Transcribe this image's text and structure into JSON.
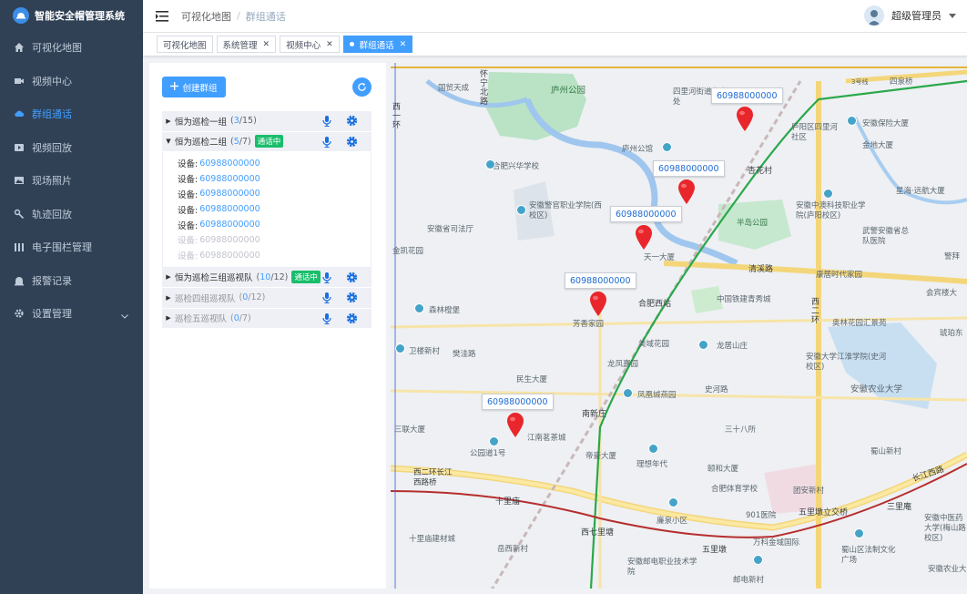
{
  "app": {
    "title": "智能安全帽管理系统"
  },
  "sidebar": {
    "items": [
      {
        "label": "可视化地图",
        "icon": "home-icon",
        "active": false
      },
      {
        "label": "视频中心",
        "icon": "video-camera-icon",
        "active": false
      },
      {
        "label": "群组通话",
        "icon": "cloud-icon",
        "active": true
      },
      {
        "label": "视频回放",
        "icon": "playback-icon",
        "active": false
      },
      {
        "label": "现场照片",
        "icon": "photo-icon",
        "active": false
      },
      {
        "label": "轨迹回放",
        "icon": "track-icon",
        "active": false
      },
      {
        "label": "电子围栏管理",
        "icon": "fence-icon",
        "active": false
      },
      {
        "label": "报警记录",
        "icon": "alarm-icon",
        "active": false
      },
      {
        "label": "设置管理",
        "icon": "settings-icon",
        "active": false
      }
    ]
  },
  "header": {
    "breadcrumb": [
      "可视化地图",
      "群组通话"
    ],
    "separator": "/",
    "user": "超级管理员"
  },
  "tags": [
    {
      "label": "可视化地图",
      "closable": false,
      "active": false
    },
    {
      "label": "系统管理",
      "closable": true,
      "active": false
    },
    {
      "label": "视频中心",
      "closable": true,
      "active": false
    },
    {
      "label": "群组通话",
      "closable": true,
      "active": true
    }
  ],
  "panel": {
    "create_label": "创建群组",
    "groups": [
      {
        "name": "恒为巡检一组",
        "online": "3",
        "total": "/15",
        "expanded": false,
        "live": "",
        "dim": false
      },
      {
        "name": "恒为巡检二组",
        "online": "5",
        "total": "/7",
        "expanded": true,
        "live": "通话中",
        "dim": false,
        "members": [
          {
            "label": "设备:",
            "id": "60988000000",
            "online": true
          },
          {
            "label": "设备:",
            "id": "60988000000",
            "online": true
          },
          {
            "label": "设备:",
            "id": "60988000000",
            "online": true
          },
          {
            "label": "设备:",
            "id": "60988000000",
            "online": true
          },
          {
            "label": "设备:",
            "id": "60988000000",
            "online": true
          },
          {
            "label": "设备:",
            "id": "60988000000",
            "online": false
          },
          {
            "label": "设备:",
            "id": "60988000000",
            "online": false
          }
        ]
      },
      {
        "name": "恒为巡检三组巡视队",
        "online": "10",
        "total": "/12",
        "expanded": false,
        "live": "通话中",
        "dim": false
      },
      {
        "name": "巡检四组巡视队",
        "online": "0",
        "total": "/12",
        "expanded": false,
        "live": "",
        "dim": true
      },
      {
        "name": "巡检五巡视队",
        "online": "0",
        "total": "/7",
        "expanded": false,
        "live": "",
        "dim": true
      }
    ]
  },
  "map": {
    "markers": [
      {
        "label": "60988000000"
      },
      {
        "label": "60988000000"
      },
      {
        "label": "60988000000"
      },
      {
        "label": "60988000000"
      },
      {
        "label": "60988000000"
      }
    ],
    "places": [
      {
        "text": "国贸天成"
      },
      {
        "text": "庐州公园"
      },
      {
        "text": "四里河街道办事处"
      },
      {
        "text": "四泉桥"
      },
      {
        "text": "庐阳区四里河社区"
      },
      {
        "text": "安徽保险大厦"
      },
      {
        "text": "金地大厦"
      },
      {
        "text": "杏花村"
      },
      {
        "text": "庐州公馆"
      },
      {
        "text": "合肥兴华学校"
      },
      {
        "text": "星海·远航大厦"
      },
      {
        "text": "安徽警官职业学院(西校区)"
      },
      {
        "text": "安徽中澳科技职业学院(庐阳校区)"
      },
      {
        "text": "安徽省司法厅"
      },
      {
        "text": "半岛公园"
      },
      {
        "text": "金凯花园"
      },
      {
        "text": "武警安徽省总队医院"
      },
      {
        "text": "天一大厦"
      },
      {
        "text": "清溪路"
      },
      {
        "text": "康居时代家园"
      },
      {
        "text": "森林橙堡"
      },
      {
        "text": "中国铁建青秀城"
      },
      {
        "text": "合肥西站"
      },
      {
        "text": "芳香家园"
      },
      {
        "text": "奥林花园汇景苑"
      },
      {
        "text": "卫楼新村"
      },
      {
        "text": "樊洼路"
      },
      {
        "text": "美域花园"
      },
      {
        "text": "龙居山庄"
      },
      {
        "text": "安徽大学江淮学院(史河校区)"
      },
      {
        "text": "龙凤嘉园"
      },
      {
        "text": "民生大厦"
      },
      {
        "text": "史河路"
      },
      {
        "text": "凤凰城燕园"
      },
      {
        "text": "安徽农业大学"
      },
      {
        "text": "南新庄"
      },
      {
        "text": "三联大厦"
      },
      {
        "text": "江南茗茶城"
      },
      {
        "text": "三十八所"
      },
      {
        "text": "公园道1号"
      },
      {
        "text": "帝豪大厦"
      },
      {
        "text": "蜀山新村"
      },
      {
        "text": "理想年代"
      },
      {
        "text": "颐和大厦"
      },
      {
        "text": "西二环长江西路桥"
      },
      {
        "text": "十里庙"
      },
      {
        "text": "合肥体育学校"
      },
      {
        "text": "团安新村"
      },
      {
        "text": "长江西路"
      },
      {
        "text": "三里庵"
      },
      {
        "text": "廉泉小区"
      },
      {
        "text": "901医院"
      },
      {
        "text": "五里墩立交桥"
      },
      {
        "text": "西七里塘"
      },
      {
        "text": "十里庙建材城"
      },
      {
        "text": "五里墩"
      },
      {
        "text": "万科金域国际"
      },
      {
        "text": "岳西新村"
      },
      {
        "text": "蜀山区法制文化广场"
      },
      {
        "text": "安徽邮电职业技术学院"
      },
      {
        "text": "邮电新村"
      },
      {
        "text": "安徽农业大学"
      },
      {
        "text": "西二环"
      },
      {
        "text": "西一环"
      },
      {
        "text": "怀宁北路"
      },
      {
        "text": "3号线"
      },
      {
        "text": "警拜"
      },
      {
        "text": "会宾楼大"
      },
      {
        "text": "琥珀东"
      },
      {
        "text": "安徽中医药大学(梅山路校区)"
      }
    ]
  },
  "colors": {
    "sidebar_bg": "#304156",
    "accent": "#409eff",
    "live": "#19be6b",
    "marker": "#e8262b"
  }
}
